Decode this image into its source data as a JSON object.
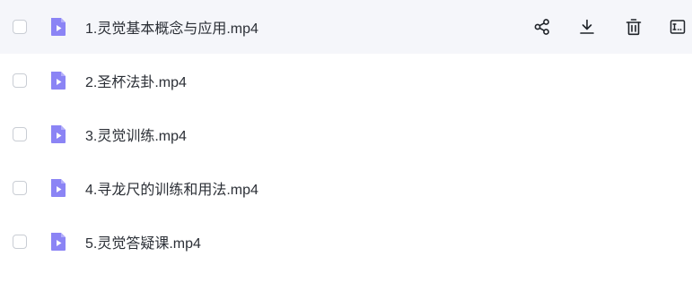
{
  "files": [
    {
      "name": "1.灵觉基本概念与应用.mp4",
      "icon": "video-file-icon"
    },
    {
      "name": "2.圣杯法卦.mp4",
      "icon": "video-file-icon"
    },
    {
      "name": "3.灵觉训练.mp4",
      "icon": "video-file-icon"
    },
    {
      "name": "4.寻龙尺的训练和用法.mp4",
      "icon": "video-file-icon"
    },
    {
      "name": "5.灵觉答疑课.mp4",
      "icon": "video-file-icon"
    }
  ],
  "row_actions": [
    {
      "icon": "share-icon"
    },
    {
      "icon": "download-icon"
    },
    {
      "icon": "delete-icon"
    },
    {
      "icon": "rename-icon"
    }
  ],
  "colors": {
    "hover_row_bg": "#f5f6fa",
    "file_icon": "#8b84f5",
    "action_icon": "#1f2329"
  }
}
